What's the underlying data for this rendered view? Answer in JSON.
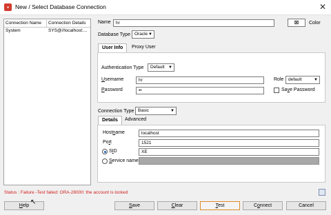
{
  "window": {
    "title": "New / Select Database Connection",
    "icon": "database-icon",
    "close_icon": "close-icon"
  },
  "connections": {
    "headers": [
      "Connection Name",
      "Connection Details"
    ],
    "rows": [
      {
        "name": "System",
        "details": "SYS@//localhost:..."
      }
    ]
  },
  "form": {
    "name_label": "Name",
    "name_value": "hr",
    "color_label": "Color",
    "dbtype_label": "Database Type",
    "dbtype_value": "Oracle",
    "tabs": [
      "User Info",
      "Proxy User"
    ],
    "auth_label": "Authentication Type",
    "auth_value": "Default",
    "username_label": "Username",
    "username_value": "hr",
    "role_label": "Role",
    "role_value": "default",
    "password_label": "Password",
    "password_value": "••",
    "save_password_label": "Save Password",
    "conn_type_label": "Connection Type",
    "conn_type_value": "Basic",
    "conn_tabs": [
      "Details",
      "Advanced"
    ],
    "hostname_label": "Hostname",
    "hostname_value": "localhost",
    "port_label": "Port",
    "port_value": "1521",
    "sid_label": "SID",
    "sid_value": "XE",
    "service_label": "Service name",
    "service_value": ""
  },
  "status": "Status : Failure -Test failed: ORA-28000: the account is locked",
  "buttons": {
    "help": "Help",
    "save": "Save",
    "clear": "Clear",
    "test": "Test",
    "connect": "Connect",
    "cancel": "Cancel"
  }
}
